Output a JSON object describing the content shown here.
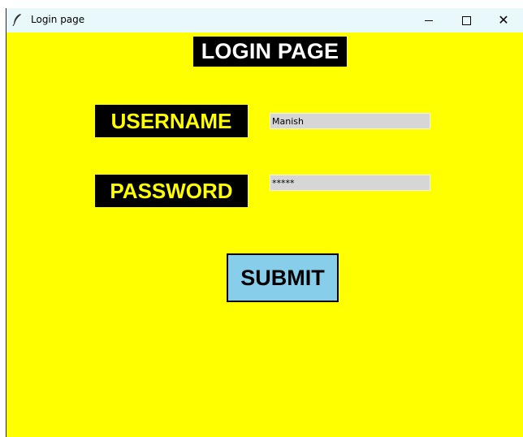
{
  "window": {
    "title": "Login page",
    "controls": {
      "minimize_icon": "minimize-icon",
      "maximize_icon": "maximize-icon",
      "close_icon": "close-icon",
      "close_glyph": "✕"
    }
  },
  "form": {
    "heading": "LOGIN PAGE",
    "username_label": "USERNAME",
    "username_value": "Manish",
    "password_label": "PASSWORD",
    "password_value": "*****",
    "submit_label": "SUBMIT"
  },
  "colors": {
    "background": "#ffff00",
    "label_bg": "#000000",
    "label_text": "#ffff00",
    "heading_text": "#ffffff",
    "submit_bg": "#87ceeb",
    "input_bg": "#d6d6d6",
    "titlebar_bg": "#e9f8fb"
  }
}
